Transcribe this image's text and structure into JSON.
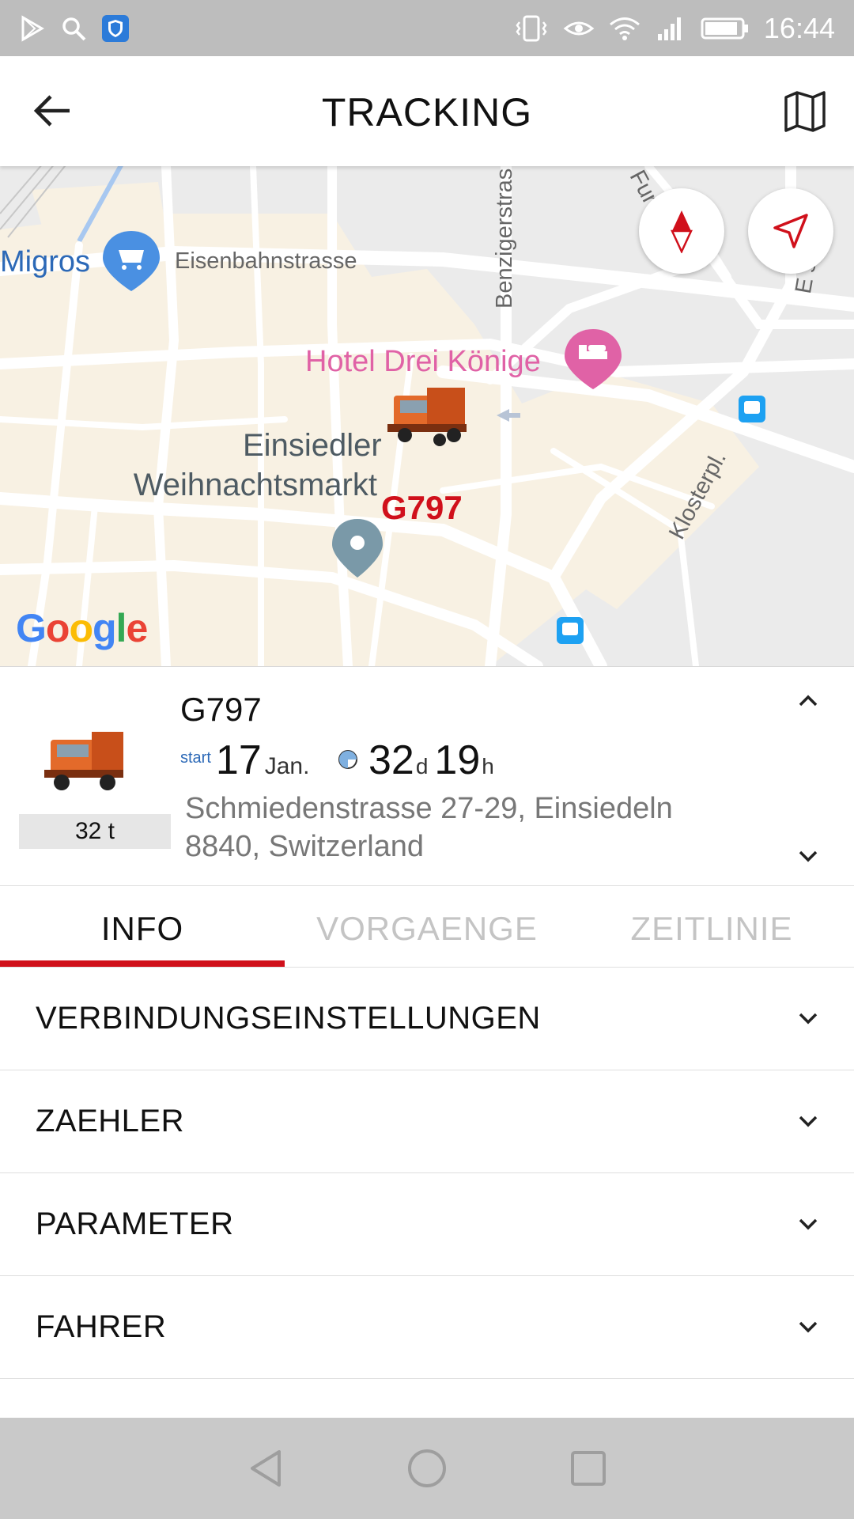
{
  "status_bar": {
    "time": "16:44"
  },
  "toolbar": {
    "title": "TRACKING"
  },
  "map": {
    "labels": {
      "migros": "Migros",
      "eisenbahnstrasse": "Eisenbahnstrasse",
      "benzigerstrasse": "Benzigerstras",
      "hotel": "Hotel Drei Könige",
      "market_line1": "Einsiedler",
      "market_line2": "Weihnachtsmarkt",
      "vehicle": "G797",
      "klosterpl": "Klosterpl.",
      "furrenstrasse": "Fur   sse",
      "other_street": "E   sse"
    },
    "attribution": "Google"
  },
  "vehicle_card": {
    "name": "G797",
    "weight": "32 t",
    "start_label": "start",
    "start_day": "17",
    "start_month": "Jan.",
    "duration_days": "32",
    "duration_days_unit": "d",
    "duration_hours": "19",
    "duration_hours_unit": "h",
    "address_line1": "Schmiedenstrasse 27-29, Einsiedeln",
    "address_line2": "8840, Switzerland"
  },
  "tabs": [
    {
      "label": "INFO",
      "active": true
    },
    {
      "label": "VORGAENGE",
      "active": false
    },
    {
      "label": "ZEITLINIE",
      "active": false
    }
  ],
  "sections": [
    {
      "label": "VERBINDUNGSEINSTELLUNGEN"
    },
    {
      "label": "ZAEHLER"
    },
    {
      "label": "PARAMETER"
    },
    {
      "label": "FAHRER"
    }
  ],
  "colors": {
    "accent": "#d0101b",
    "migros_blue": "#2c69b7",
    "hotel_pink": "#e062a6"
  },
  "icons": {
    "toolbar_left": "arrow-left-icon",
    "toolbar_right": "map-icon",
    "map_compass": "compass-icon",
    "map_locate": "navigation-arrow-icon"
  }
}
